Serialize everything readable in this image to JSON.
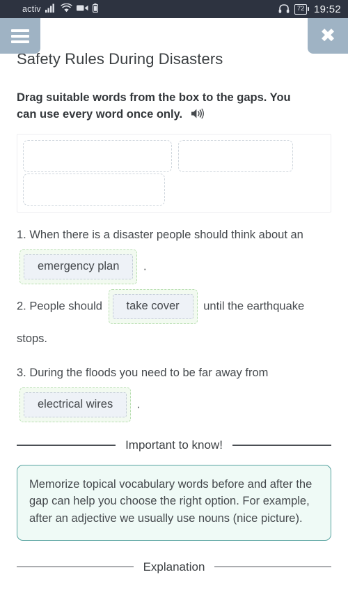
{
  "statusbar": {
    "carrier": "activ",
    "signal_icon": "signal-bars-icon",
    "wifi_icon": "wifi-icon",
    "camera_icon": "video-camera-icon",
    "battery_small_icon": "battery-icon",
    "headphones_icon": "headphones-icon",
    "battery_percent": "72",
    "time": "19:52"
  },
  "header": {
    "menu_icon": "hamburger-menu-icon",
    "close_icon": "close-icon",
    "accent_color": "#9fb3c4"
  },
  "page": {
    "title": "Safety Rules During Disasters",
    "instruction": "Drag suitable words from the box to the gaps. You can use every word once only.",
    "speaker_icon": "speaker-icon"
  },
  "wordbank": {
    "slots": [
      {
        "id": "slot-1",
        "word": ""
      },
      {
        "id": "slot-2",
        "word": ""
      },
      {
        "id": "slot-3",
        "word": ""
      }
    ]
  },
  "sentences": [
    {
      "before": "1. When there is a disaster people should think about an",
      "answer": "emergency plan",
      "after": "."
    },
    {
      "before": "2. People should",
      "answer": "take cover",
      "after": "until the earthquake stops."
    },
    {
      "before": "3. During the floods you need to be far away from",
      "answer": "electrical wires",
      "after": "."
    }
  ],
  "tip_section": {
    "divider_label": "Important to know!",
    "body": "Memorize topical vocabulary words before and after the gap can help you choose the right option. For example, after an adjective we usually use nouns (nice picture).",
    "border_color": "#57a3a0",
    "background_color": "#effaf6"
  },
  "explanation_section": {
    "divider_label": "Explanation"
  }
}
